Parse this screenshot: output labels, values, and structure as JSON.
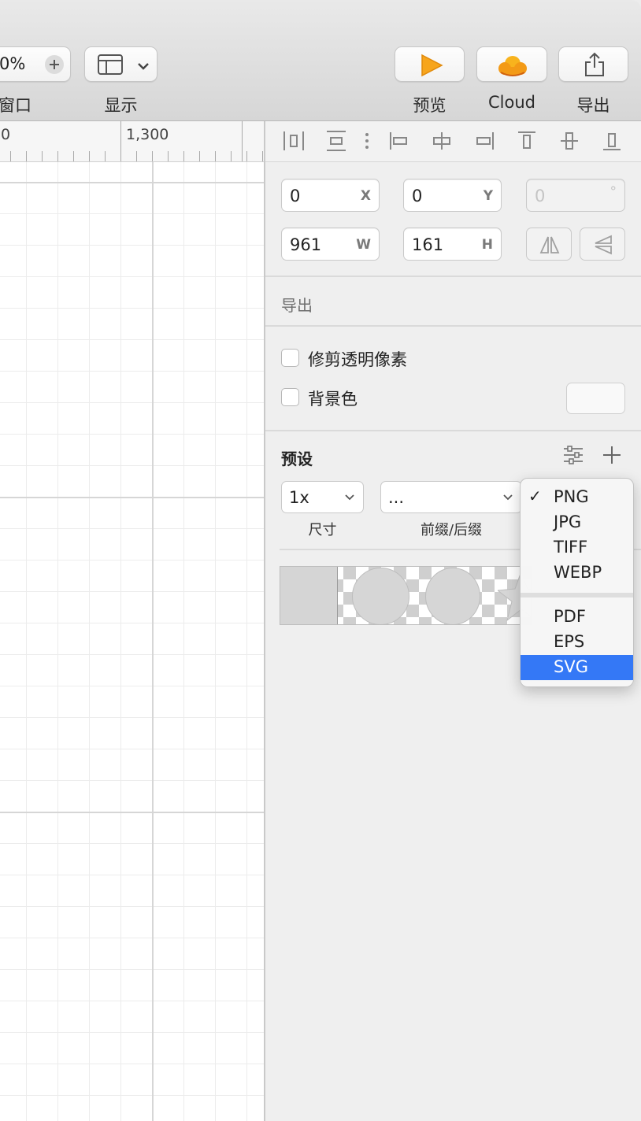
{
  "toolbar": {
    "zoom_value": "0%",
    "items": [
      {
        "label": "窗口"
      },
      {
        "label": "显示"
      },
      {
        "label": "预览"
      },
      {
        "label": "Cloud"
      },
      {
        "label": "导出"
      }
    ],
    "icons": {
      "zoom_in": "plus-icon",
      "display": "layout-icon",
      "preview": "play-icon",
      "cloud": "cloud-icon",
      "export": "share-icon"
    },
    "preview_color": "#f6a623",
    "cloud_color": "#f5a623"
  },
  "ruler": {
    "labels": [
      "0",
      "1,300"
    ]
  },
  "inspector": {
    "x": {
      "value": "0",
      "suffix": "X"
    },
    "y": {
      "value": "0",
      "suffix": "Y"
    },
    "rotation": {
      "value": "0",
      "suffix": "°"
    },
    "w": {
      "value": "961",
      "suffix": "W"
    },
    "h": {
      "value": "161",
      "suffix": "H"
    },
    "export_title": "导出",
    "trim_label": "修剪透明像素",
    "background_label": "背景色",
    "preset_title": "预设",
    "size_value": "1x",
    "size_label": "尺寸",
    "prefix_value": "...",
    "prefix_label": "前缀/后缀"
  },
  "format_menu": {
    "items": [
      {
        "label": "PNG",
        "checked": true
      },
      {
        "label": "JPG"
      },
      {
        "label": "TIFF"
      },
      {
        "label": "WEBP"
      },
      {
        "label": "PDF"
      },
      {
        "label": "EPS"
      },
      {
        "label": "SVG",
        "highlighted": true
      }
    ],
    "highlight_color": "#3478f6"
  }
}
